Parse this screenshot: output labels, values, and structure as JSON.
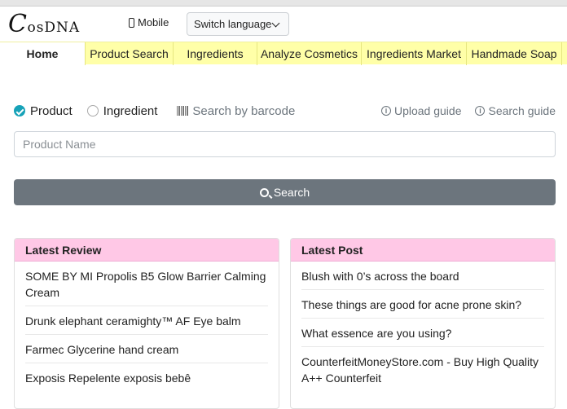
{
  "header": {
    "logo_c": "C",
    "logo_rest": "osDNA",
    "mobile_label": "Mobile",
    "language_label": "Switch language"
  },
  "nav": {
    "items": [
      "Home",
      "Product Search",
      "Ingredients",
      "Analyze Cosmetics",
      "Ingredients Market",
      "Handmade Soap"
    ]
  },
  "search": {
    "option_product": "Product",
    "option_ingredient": "Ingredient",
    "barcode_label": "Search by barcode",
    "upload_guide": "Upload guide",
    "search_guide": "Search guide",
    "placeholder": "Product Name",
    "button_label": "Search"
  },
  "latest_review": {
    "title": "Latest Review",
    "items": [
      "SOME BY MI Propolis B5 Glow Barrier Calming Cream",
      "Drunk elephant ceramighty™ AF Eye balm",
      "Farmec Glycerine hand cream",
      "Exposis Repelente exposis bebê"
    ]
  },
  "latest_post": {
    "title": "Latest Post",
    "items": [
      "Blush with 0’s across the board",
      "These things are good for acne prone skin?",
      "What essence are you using?",
      "CounterfeitMoneyStore.com - Buy High Quality A++ Counterfeit"
    ]
  },
  "colors": {
    "nav_bg": "#ffffa8",
    "card_header": "#ffc8e6",
    "button": "#6c757d",
    "radio_on": "#17a2b8"
  }
}
